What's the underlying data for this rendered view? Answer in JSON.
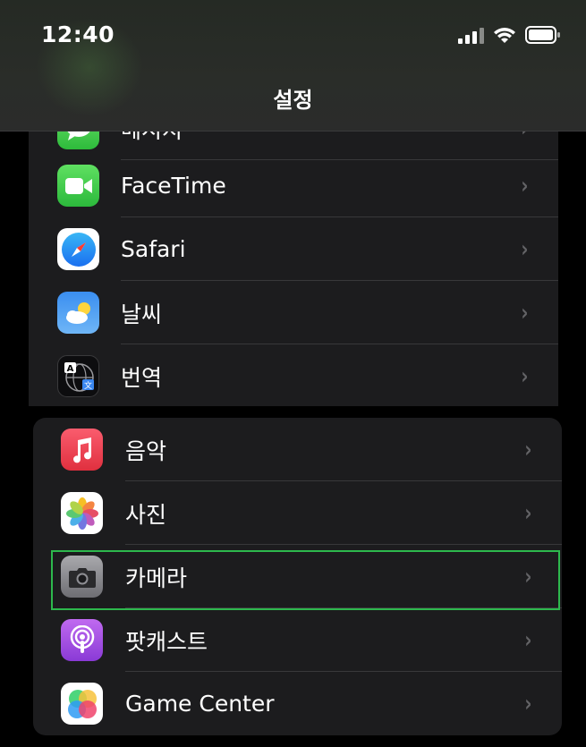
{
  "status_bar": {
    "time": "12:40"
  },
  "nav": {
    "title": "설정"
  },
  "group1": {
    "items": [
      {
        "label": "메시지",
        "icon": "messages-icon"
      },
      {
        "label": "FaceTime",
        "icon": "facetime-icon"
      },
      {
        "label": "Safari",
        "icon": "safari-icon"
      },
      {
        "label": "날씨",
        "icon": "weather-icon"
      },
      {
        "label": "번역",
        "icon": "translate-icon"
      }
    ]
  },
  "group2": {
    "items": [
      {
        "label": "음악",
        "icon": "music-icon"
      },
      {
        "label": "사진",
        "icon": "photos-icon"
      },
      {
        "label": "카메라",
        "icon": "camera-icon"
      },
      {
        "label": "팟캐스트",
        "icon": "podcasts-icon"
      },
      {
        "label": "Game Center",
        "icon": "game-center-icon"
      }
    ]
  },
  "chevron": "›",
  "colors": {
    "background": "#000000",
    "cell": "#1c1c1e",
    "separator": "#38383a",
    "highlight": "#2db84d"
  }
}
